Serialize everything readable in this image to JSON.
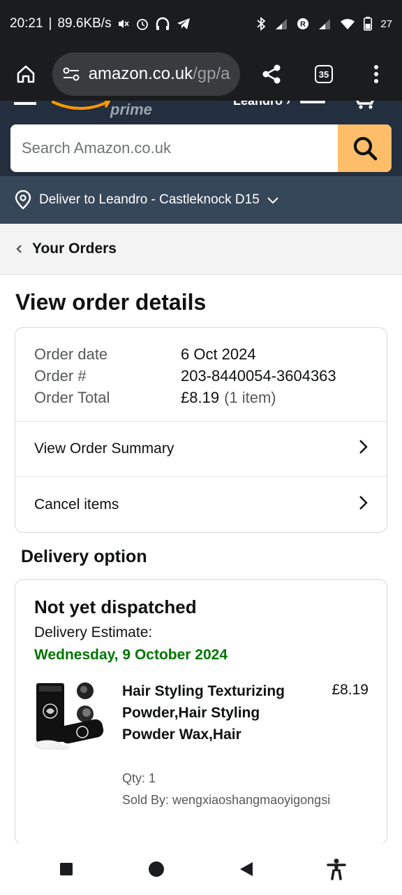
{
  "status_bar": {
    "time": "20:21",
    "speed": "89.6KB/s",
    "battery": "27",
    "icons": [
      "mute-icon",
      "alarm-icon",
      "headphones-icon",
      "telegram-icon",
      "bluetooth-icon",
      "signal-icon",
      "roaming-icon",
      "signal-icon",
      "wifi-icon",
      "battery-icon"
    ]
  },
  "browser": {
    "url_host": "amazon.co.uk",
    "url_path": "/gp/a",
    "tabs_count": "35",
    "icons": [
      "home-icon",
      "site-settings-icon",
      "share-icon",
      "tabs-icon",
      "more-icon"
    ]
  },
  "header": {
    "prime_text": "prime",
    "account_partial": "Leandro ›",
    "search_placeholder": "Search Amazon.co.uk"
  },
  "deliver": {
    "label": "Deliver to Leandro - Castleknock D15"
  },
  "breadcrumb": {
    "label": "Your Orders"
  },
  "page": {
    "title": "View order details"
  },
  "order": {
    "date_label": "Order date",
    "date_value": "6 Oct 2024",
    "number_label": "Order #",
    "number_value": "203-8440054-3604363",
    "total_label": "Order Total",
    "total_value": "£8.19",
    "total_items": "(1 item)",
    "links": [
      {
        "label": "View Order Summary"
      },
      {
        "label": "Cancel items"
      }
    ]
  },
  "delivery": {
    "heading": "Delivery option",
    "status": "Not yet dispatched",
    "estimate_label": "Delivery Estimate:",
    "estimate_date": "Wednesday, 9 October 2024",
    "estimate_color": "#007600",
    "product": {
      "title": "Hair Styling Texturizing Powder,Hair Styling Powder Wax,Hair",
      "price": "£8.19",
      "qty": "Qty: 1",
      "seller": "Sold By: wengxiaoshangmaoyigongsi"
    }
  },
  "nav": {
    "icons": [
      "recents-icon",
      "home-circle-icon",
      "back-icon",
      "accessibility-icon"
    ]
  },
  "colors": {
    "header_bg": "#232f3e",
    "deliver_bg": "#37475a",
    "search_button": "#febd69"
  }
}
